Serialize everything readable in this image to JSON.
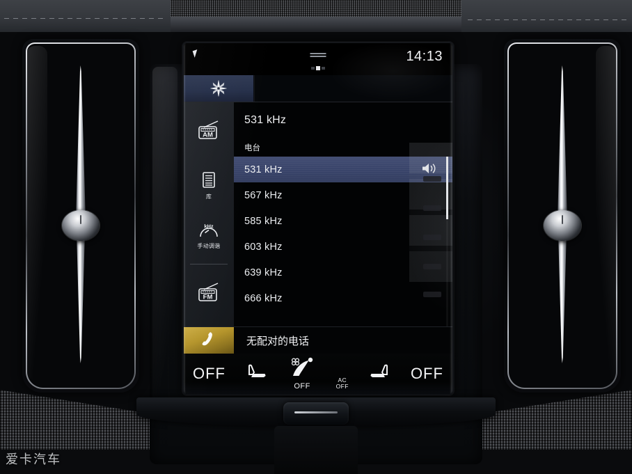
{
  "status_bar": {
    "clock": "14:13",
    "drag_handle_icon": "drag-handle-icon",
    "page_dot_icon": "page-indicator-dot"
  },
  "nav_tile": {
    "icon": "compass-rose-icon",
    "label": ""
  },
  "sidebar": {
    "items": [
      {
        "icon": "am-radio-icon",
        "label": "",
        "name": "am-band"
      },
      {
        "icon": "library-list-icon",
        "label": "库",
        "name": "library"
      },
      {
        "icon": "khz-manual-tune-icon",
        "label": "手动调谐",
        "name": "manual-tune"
      },
      {
        "icon": "fm-radio-icon",
        "label": "",
        "name": "fm-band"
      }
    ]
  },
  "media": {
    "now_playing_frequency": "531 kHz",
    "list_title": "电台",
    "stations": [
      {
        "label": "531 kHz",
        "selected": true,
        "speaker_icon": "speaker-playing-icon"
      },
      {
        "label": "567 kHz",
        "selected": false,
        "speaker_icon": ""
      },
      {
        "label": "585 kHz",
        "selected": false,
        "speaker_icon": ""
      },
      {
        "label": "603 kHz",
        "selected": false,
        "speaker_icon": ""
      },
      {
        "label": "639 kHz",
        "selected": false,
        "speaker_icon": ""
      },
      {
        "label": "666 kHz",
        "selected": false,
        "speaker_icon": ""
      }
    ]
  },
  "phone_bar": {
    "icon": "phone-handset-icon",
    "text": "无配对的电话"
  },
  "climate_bar": {
    "left_temp": "OFF",
    "left_seat_icon": "seat-heater-left-icon",
    "fan_icon": "fan-seat-airflow-icon",
    "fan_status": "OFF",
    "ac_line1": "AC",
    "ac_line2": "OFF",
    "right_seat_icon": "seat-heater-right-icon",
    "right_temp": "OFF"
  },
  "watermark": {
    "text": "爱卡汽车"
  },
  "colors": {
    "selected_row": "#39446a",
    "nav_tile": "#26304a",
    "phone_tile": "#b5952c",
    "screen_bg": "#000000",
    "sidebar_bg": "#1c1f24",
    "text": "#f2f3f5"
  }
}
